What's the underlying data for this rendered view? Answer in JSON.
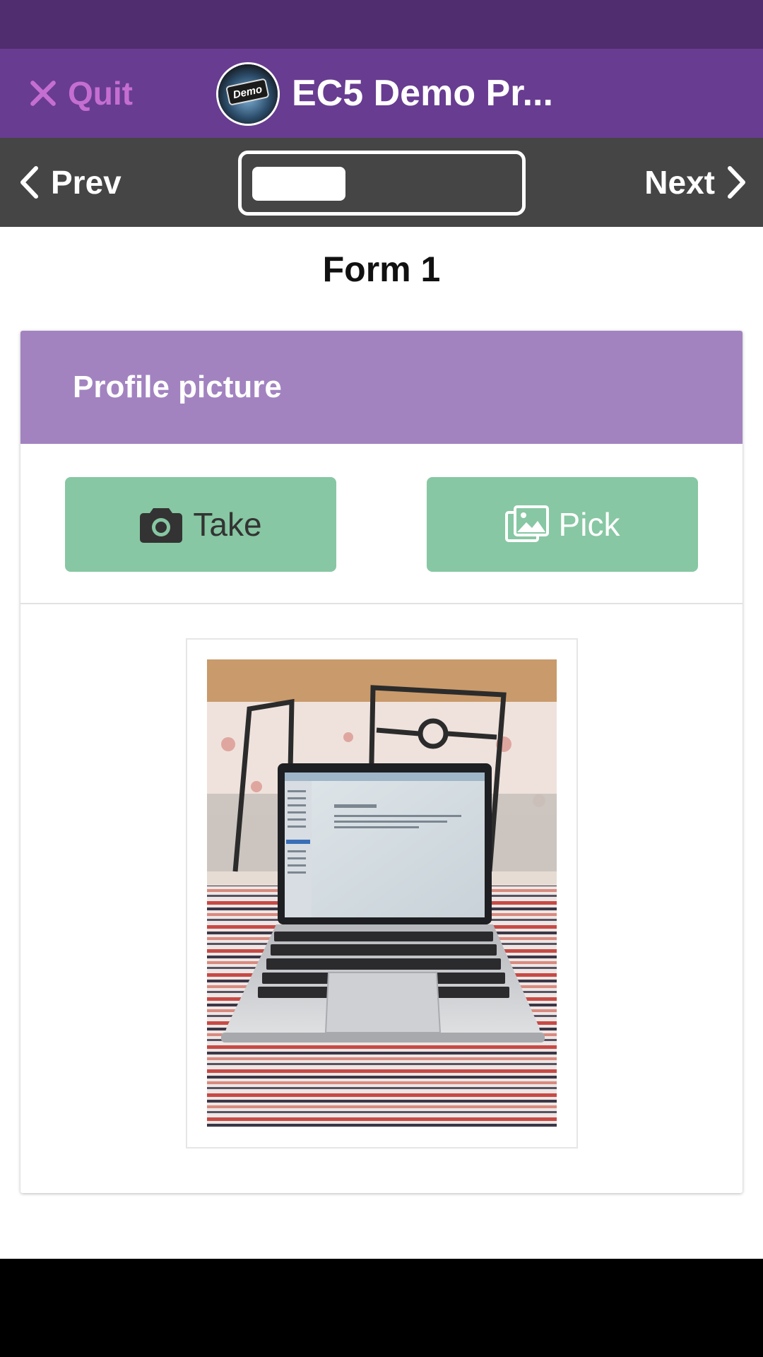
{
  "header": {
    "quit_label": "Quit",
    "logo_text": "Demo",
    "project_title": "EC5 Demo Pr..."
  },
  "nav": {
    "prev_label": "Prev",
    "next_label": "Next",
    "progress_fraction": 0.36
  },
  "form": {
    "title": "Form 1"
  },
  "question": {
    "title": "Profile picture",
    "take_label": "Take",
    "pick_label": "Pick"
  },
  "colors": {
    "status_bar": "#4f2d6f",
    "header": "#683c91",
    "quit": "#c56ed1",
    "nav_bar": "#454545",
    "card_header": "#a283c0",
    "button": "#87c7a3"
  },
  "icons": {
    "quit": "close-icon",
    "prev": "chevron-left-icon",
    "next": "chevron-right-icon",
    "take": "camera-icon",
    "pick": "images-icon"
  }
}
